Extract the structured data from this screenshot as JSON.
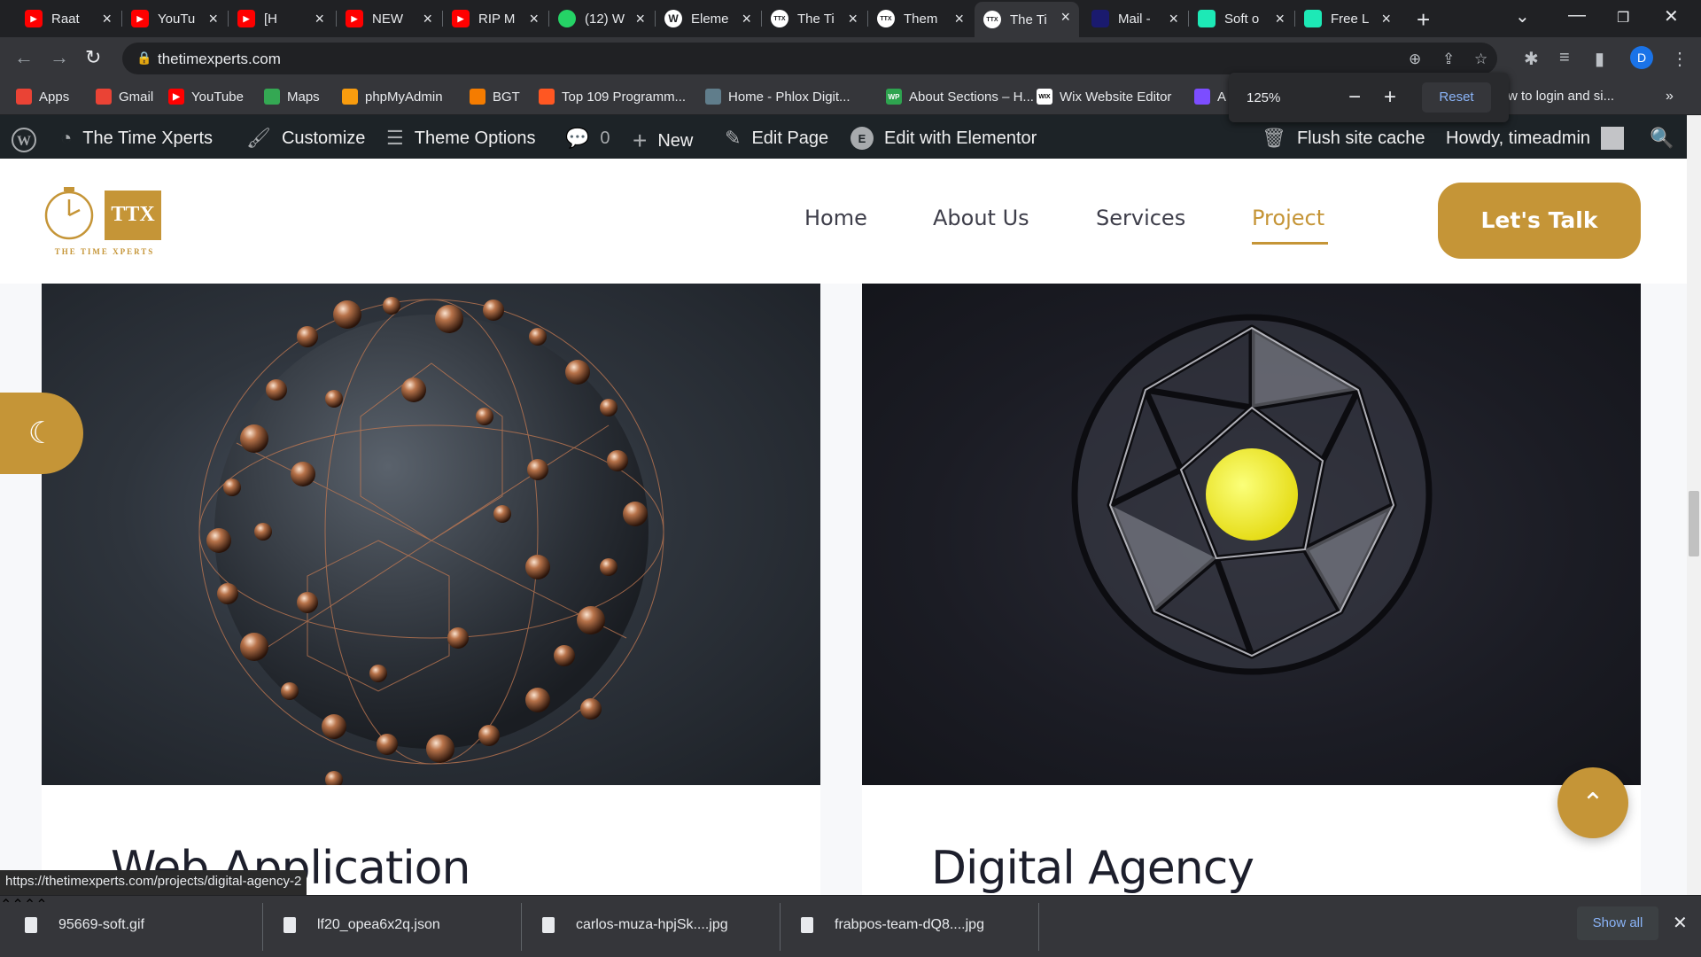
{
  "browser": {
    "tabs": [
      {
        "title": "Raat",
        "favicon": "youtube-icon",
        "color": "#ff0000"
      },
      {
        "title": "YouTu",
        "favicon": "youtube-icon",
        "color": "#ff0000"
      },
      {
        "title": "[H",
        "favicon": "youtube-icon",
        "color": "#ff0000"
      },
      {
        "title": "NEW",
        "favicon": "youtube-icon",
        "color": "#ff0000"
      },
      {
        "title": "RIP M",
        "favicon": "youtube-icon",
        "color": "#ff0000"
      },
      {
        "title": "(12) W",
        "favicon": "whatsapp-icon",
        "color": "#25d366"
      },
      {
        "title": "Eleme",
        "favicon": "wordpress-icon",
        "color": "#ffffff"
      },
      {
        "title": "The Ti",
        "favicon": "ttx-icon",
        "color": "#ffffff"
      },
      {
        "title": "Them",
        "favicon": "ttx-icon",
        "color": "#ffffff"
      },
      {
        "title": "The Ti",
        "favicon": "ttx-icon",
        "color": "#ffffff"
      },
      {
        "title": "Mail -",
        "favicon": "mail-icon",
        "color": "#1a1a6e"
      },
      {
        "title": "Soft o",
        "favicon": "soft-icon",
        "color": "#1de9b6"
      },
      {
        "title": "Free L",
        "favicon": "soft-icon",
        "color": "#1de9b6"
      }
    ],
    "active_tab_index": 9,
    "url": "thetimexperts.com",
    "profile_letter": "D",
    "zoom": {
      "level": "125%",
      "reset_label": "Reset"
    },
    "bookmarks": [
      {
        "label": "Apps",
        "icon": "apps-icon",
        "color": "#ea4335"
      },
      {
        "label": "Gmail",
        "icon": "gmail-icon",
        "color": "#ea4335"
      },
      {
        "label": "YouTube",
        "icon": "youtube-icon",
        "color": "#ff0000"
      },
      {
        "label": "Maps",
        "icon": "maps-icon",
        "color": "#34a853"
      },
      {
        "label": "phpMyAdmin",
        "icon": "phpmyadmin-icon",
        "color": "#f89c0e"
      },
      {
        "label": "BGT",
        "icon": "bgt-icon",
        "color": "#f57c00"
      },
      {
        "label": "Top 109 Programm...",
        "icon": "c-icon",
        "color": "#ff5722"
      },
      {
        "label": "Home - Phlox Digit...",
        "icon": "phlox-icon",
        "color": "#607d8b"
      },
      {
        "label": "About Sections – H...",
        "icon": "wp-icon",
        "color": "#2ea44f"
      },
      {
        "label": "Wix Website Editor",
        "icon": "wix-icon",
        "color": "#ffffff"
      },
      {
        "label": "A",
        "icon": "heart-icon",
        "color": "#7c4dff"
      },
      {
        "label": "w to login and si...",
        "icon": "",
        "color": ""
      }
    ],
    "status_url": "https://thetimexperts.com/projects/digital-agency-2",
    "downloads": [
      {
        "name": "95669-soft.gif"
      },
      {
        "name": "lf20_opea6x2q.json"
      },
      {
        "name": "carlos-muza-hpjSk....jpg"
      },
      {
        "name": "frabpos-team-dQ8....jpg"
      }
    ],
    "show_all_label": "Show all"
  },
  "wp_admin_bar": {
    "site_name": "The Time Xperts",
    "customize": "Customize",
    "theme_options": "Theme Options",
    "comments_count": "0",
    "new": "New",
    "edit_page": "Edit Page",
    "edit_elementor": "Edit with Elementor",
    "flush_cache": "Flush site cache",
    "howdy": "Howdy, timeadmin"
  },
  "site": {
    "logo_text": "TTX",
    "logo_tagline": "THE TIME XPERTS",
    "nav": [
      "Home",
      "About Us",
      "Services",
      "Project"
    ],
    "active_nav": "Project",
    "cta_label": "Let's Talk",
    "accent_color": "#c59537",
    "cards": [
      {
        "title": "Web Application"
      },
      {
        "title": "Digital Agency"
      }
    ]
  }
}
